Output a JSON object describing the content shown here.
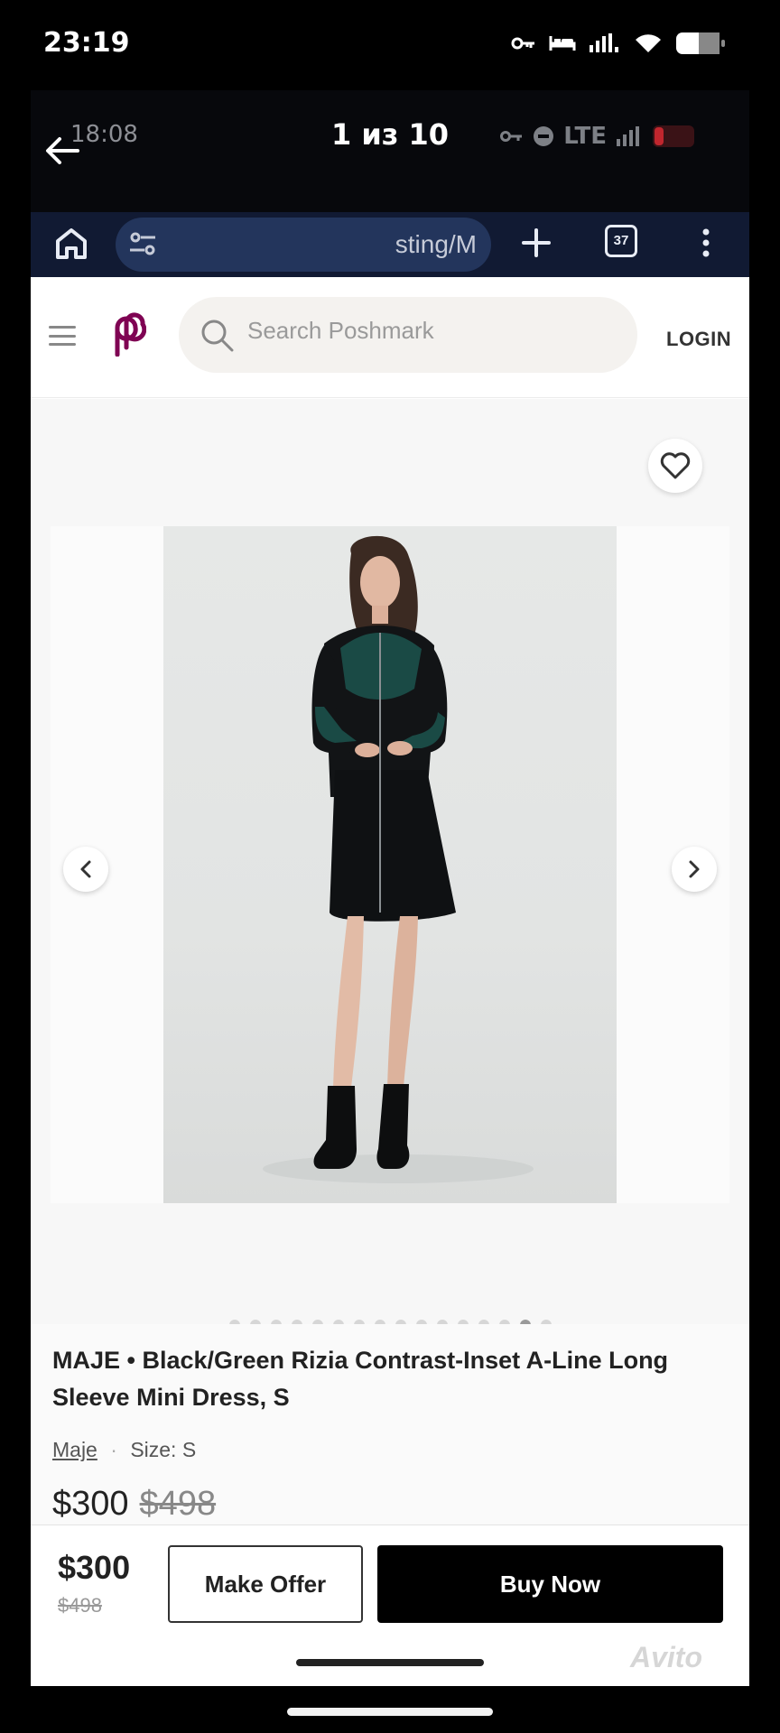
{
  "device_status": {
    "time": "23:19",
    "icons": [
      "key-icon",
      "bed-icon",
      "signal-icon",
      "wifi-icon",
      "battery-icon"
    ]
  },
  "viewer": {
    "inner_time": "18:08",
    "counter": "1 из 10",
    "inner_network": "LTE",
    "icons": [
      "back-arrow-icon",
      "key-icon",
      "dnd-icon",
      "signal-icon",
      "battery-low-icon"
    ]
  },
  "browser": {
    "url_fragment": "sting/M",
    "tab_count": "37",
    "icons": [
      "home-icon",
      "tune-icon",
      "plus-icon",
      "more-vert-icon"
    ]
  },
  "site": {
    "search_placeholder": "Search Poshmark",
    "login_label": "LOGIN",
    "icons": [
      "hamburger-icon",
      "poshmark-logo",
      "search-icon"
    ]
  },
  "listing": {
    "title": "MAJE • Black/Green Rizia Contrast-Inset A-Line Long Sleeve Mini Dress, S",
    "brand": "Maje",
    "separator": "·",
    "size": "Size: S",
    "price": "$300",
    "original_price": "$498",
    "photo_count": 16,
    "active_photo_index": 14,
    "icons": [
      "heart-icon",
      "chevron-left-icon",
      "chevron-right-icon"
    ]
  },
  "buy_bar": {
    "price": "$300",
    "original_price": "$498",
    "make_offer_label": "Make Offer",
    "buy_now_label": "Buy Now"
  },
  "watermark": "Avito",
  "colors": {
    "brand": "#7f0353",
    "browser_bar": "#111a33",
    "url_pill": "#23355c",
    "buy_now": "#000000"
  }
}
